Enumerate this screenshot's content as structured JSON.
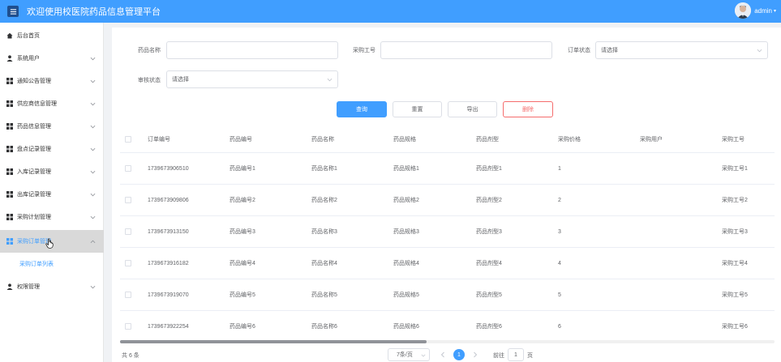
{
  "header": {
    "title": "欢迎使用校医院药品信息管理平台",
    "user": "admin",
    "bar_color": "#409eff"
  },
  "sidebar": {
    "items": [
      {
        "label": "后台首页",
        "icon": "home-icon",
        "expandable": false
      },
      {
        "label": "系统用户",
        "icon": "user-icon",
        "expandable": true
      },
      {
        "label": "通知公告管理",
        "icon": "grid-icon",
        "expandable": true
      },
      {
        "label": "供应商信息管理",
        "icon": "grid-icon",
        "expandable": true
      },
      {
        "label": "药品信息管理",
        "icon": "grid-icon",
        "expandable": true
      },
      {
        "label": "盘点记录管理",
        "icon": "grid-icon",
        "expandable": true
      },
      {
        "label": "入库记录管理",
        "icon": "grid-icon",
        "expandable": true
      },
      {
        "label": "出库记录管理",
        "icon": "grid-icon",
        "expandable": true
      },
      {
        "label": "采购计划管理",
        "icon": "grid-icon",
        "expandable": true
      },
      {
        "label": "采购订单管理",
        "icon": "grid-icon",
        "expandable": true,
        "active": true
      },
      {
        "label": "权限管理",
        "icon": "user-icon",
        "expandable": true
      }
    ],
    "sub_item": "采购订单列表"
  },
  "filters": {
    "drug_name_label": "药品名称",
    "drug_name_value": "",
    "purchase_no_label": "采购工号",
    "purchase_no_value": "",
    "order_status_label": "订单状态",
    "order_status_value": "请选择",
    "review_status_label": "审核状态",
    "review_status_value": "请选择"
  },
  "actions": {
    "query": "查询",
    "reset": "重置",
    "export": "导出",
    "delete": "删除"
  },
  "table": {
    "headers": [
      "订单编号",
      "药品编号",
      "药品名称",
      "药品规格",
      "药品剂型",
      "采购价格",
      "采购用户",
      "采购工号"
    ],
    "rows": [
      [
        "1739673906510",
        "药品编号1",
        "药品名称1",
        "药品规格1",
        "药品剂型1",
        "1",
        "",
        "采购工号1"
      ],
      [
        "1739673909806",
        "药品编号2",
        "药品名称2",
        "药品规格2",
        "药品剂型2",
        "2",
        "",
        "采购工号2"
      ],
      [
        "1739673913150",
        "药品编号3",
        "药品名称3",
        "药品规格3",
        "药品剂型3",
        "3",
        "",
        "采购工号3"
      ],
      [
        "1739673916182",
        "药品编号4",
        "药品名称4",
        "药品规格4",
        "药品剂型4",
        "4",
        "",
        "采购工号4"
      ],
      [
        "1739673919070",
        "药品编号5",
        "药品名称5",
        "药品规格5",
        "药品剂型5",
        "5",
        "",
        "采购工号5"
      ],
      [
        "1739673922254",
        "药品编号6",
        "药品名称6",
        "药品规格6",
        "药品剂型6",
        "6",
        "",
        "采购工号6"
      ]
    ]
  },
  "pagination": {
    "total": "共 6 条",
    "page_size": "7条/页",
    "current_page": "1",
    "goto_label": "前往",
    "goto_value": "1",
    "goto_suffix": "页"
  }
}
